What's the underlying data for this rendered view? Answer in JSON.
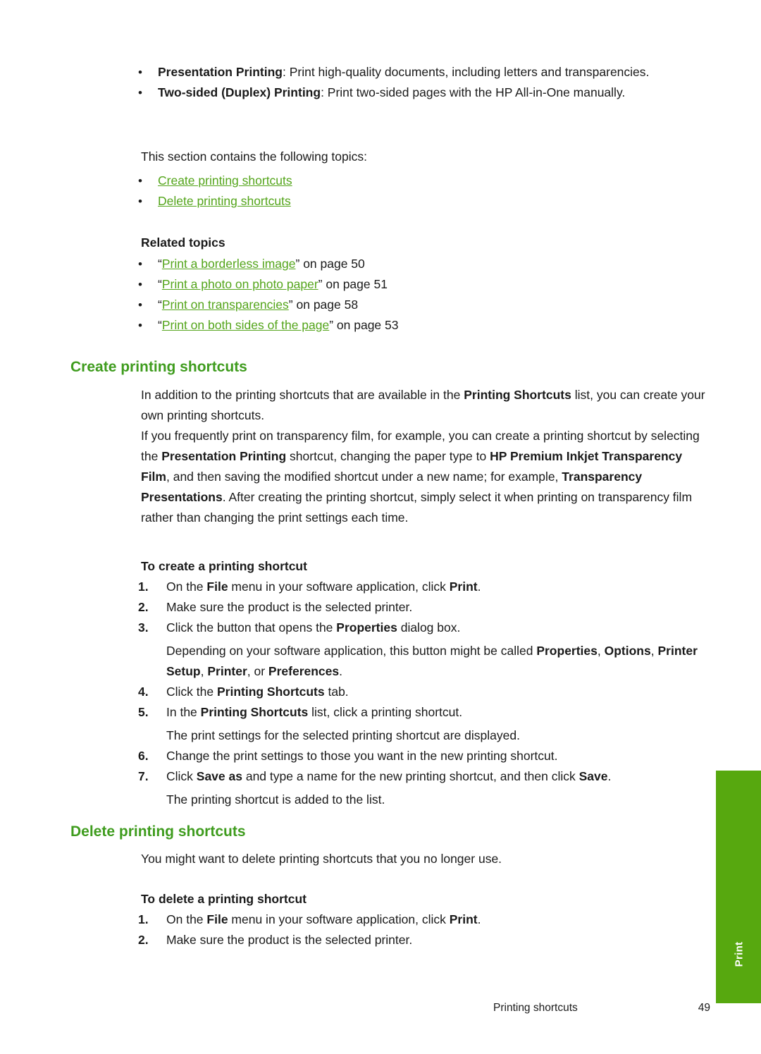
{
  "intro_bullets": [
    {
      "bold": "Presentation Printing",
      "rest": ": Print high-quality documents, including letters and transparencies."
    },
    {
      "bold": "Two-sided (Duplex) Printing",
      "rest": ": Print two-sided pages with the HP All-in-One manually."
    }
  ],
  "this_section_line": "This section contains the following topics:",
  "topic_links": [
    "Create printing shortcuts",
    "Delete printing shortcuts"
  ],
  "related_topics_heading": "Related topics",
  "related_topics": [
    {
      "open_quote": "“",
      "link": "Print a borderless image",
      "close": "” on page 50"
    },
    {
      "open_quote": "“",
      "link": "Print a photo on photo paper",
      "close": "” on page 51"
    },
    {
      "open_quote": "“",
      "link": "Print on transparencies",
      "close": "” on page 58"
    },
    {
      "open_quote": "“",
      "link": "Print on both sides of the page",
      "close": "” on page 53"
    }
  ],
  "create_section": {
    "heading": "Create printing shortcuts",
    "paragraph1_part1": "In addition to the printing shortcuts that are available in the ",
    "paragraph1_bold1": "Printing Shortcuts",
    "paragraph1_part2": " list, you can create your own printing shortcuts.",
    "paragraph2_part1": "If you frequently print on transparency film, for example, you can create a printing shortcut by selecting the ",
    "paragraph2_bold1": "Presentation Printing",
    "paragraph2_part2": " shortcut, changing the paper type to ",
    "paragraph2_bold2": "HP Premium Inkjet Transparency Film",
    "paragraph2_part3": ", and then saving the modified shortcut under a new name; for example, ",
    "paragraph2_bold3": "Transparency Presentations",
    "paragraph2_part4": ". After creating the printing shortcut, simply select it when printing on transparency film rather than changing the print settings each time.",
    "subheading": "To create a printing shortcut",
    "steps": [
      {
        "num": "1.",
        "segments": [
          {
            "t": "On the ",
            "b": false
          },
          {
            "t": "File",
            "b": true
          },
          {
            "t": " menu in your software application, click ",
            "b": false
          },
          {
            "t": "Print",
            "b": true
          },
          {
            "t": ".",
            "b": false
          }
        ]
      },
      {
        "num": "2.",
        "segments": [
          {
            "t": "Make sure the product is the selected printer.",
            "b": false
          }
        ]
      },
      {
        "num": "3.",
        "segments": [
          {
            "t": "Click the button that opens the ",
            "b": false
          },
          {
            "t": "Properties",
            "b": true
          },
          {
            "t": " dialog box.",
            "b": false
          }
        ],
        "continuation": [
          {
            "t": "Depending on your software application, this button might be called ",
            "b": false
          },
          {
            "t": "Properties",
            "b": true
          },
          {
            "t": ", ",
            "b": false
          },
          {
            "t": "Options",
            "b": true
          },
          {
            "t": ", ",
            "b": false
          },
          {
            "t": "Printer Setup",
            "b": true
          },
          {
            "t": ", ",
            "b": false
          },
          {
            "t": "Printer",
            "b": true
          },
          {
            "t": ", or ",
            "b": false
          },
          {
            "t": "Preferences",
            "b": true
          },
          {
            "t": ".",
            "b": false
          }
        ]
      },
      {
        "num": "4.",
        "segments": [
          {
            "t": "Click the ",
            "b": false
          },
          {
            "t": "Printing Shortcuts",
            "b": true
          },
          {
            "t": " tab.",
            "b": false
          }
        ]
      },
      {
        "num": "5.",
        "segments": [
          {
            "t": "In the ",
            "b": false
          },
          {
            "t": "Printing Shortcuts",
            "b": true
          },
          {
            "t": " list, click a printing shortcut.",
            "b": false
          }
        ],
        "continuation": [
          {
            "t": "The print settings for the selected printing shortcut are displayed.",
            "b": false
          }
        ]
      },
      {
        "num": "6.",
        "segments": [
          {
            "t": "Change the print settings to those you want in the new printing shortcut.",
            "b": false
          }
        ]
      },
      {
        "num": "7.",
        "segments": [
          {
            "t": "Click ",
            "b": false
          },
          {
            "t": "Save as",
            "b": true
          },
          {
            "t": " and type a name for the new printing shortcut, and then click ",
            "b": false
          },
          {
            "t": "Save",
            "b": true
          },
          {
            "t": ".",
            "b": false
          }
        ],
        "continuation": [
          {
            "t": "The printing shortcut is added to the list.",
            "b": false
          }
        ]
      }
    ]
  },
  "delete_section": {
    "heading": "Delete printing shortcuts",
    "paragraph1": "You might want to delete printing shortcuts that you no longer use.",
    "subheading": "To delete a printing shortcut",
    "steps": [
      {
        "num": "1.",
        "segments": [
          {
            "t": "On the ",
            "b": false
          },
          {
            "t": "File",
            "b": true
          },
          {
            "t": " menu in your software application, click ",
            "b": false
          },
          {
            "t": "Print",
            "b": true
          },
          {
            "t": ".",
            "b": false
          }
        ]
      },
      {
        "num": "2.",
        "segments": [
          {
            "t": "Make sure the product is the selected printer.",
            "b": false
          }
        ]
      }
    ]
  },
  "side_tab_label": "Print",
  "footer": {
    "label": "Printing shortcuts",
    "page": "49"
  },
  "colors": {
    "heading_green": "#3f9c1e",
    "link_green": "#54a51b",
    "tab_green": "#57a80f"
  }
}
